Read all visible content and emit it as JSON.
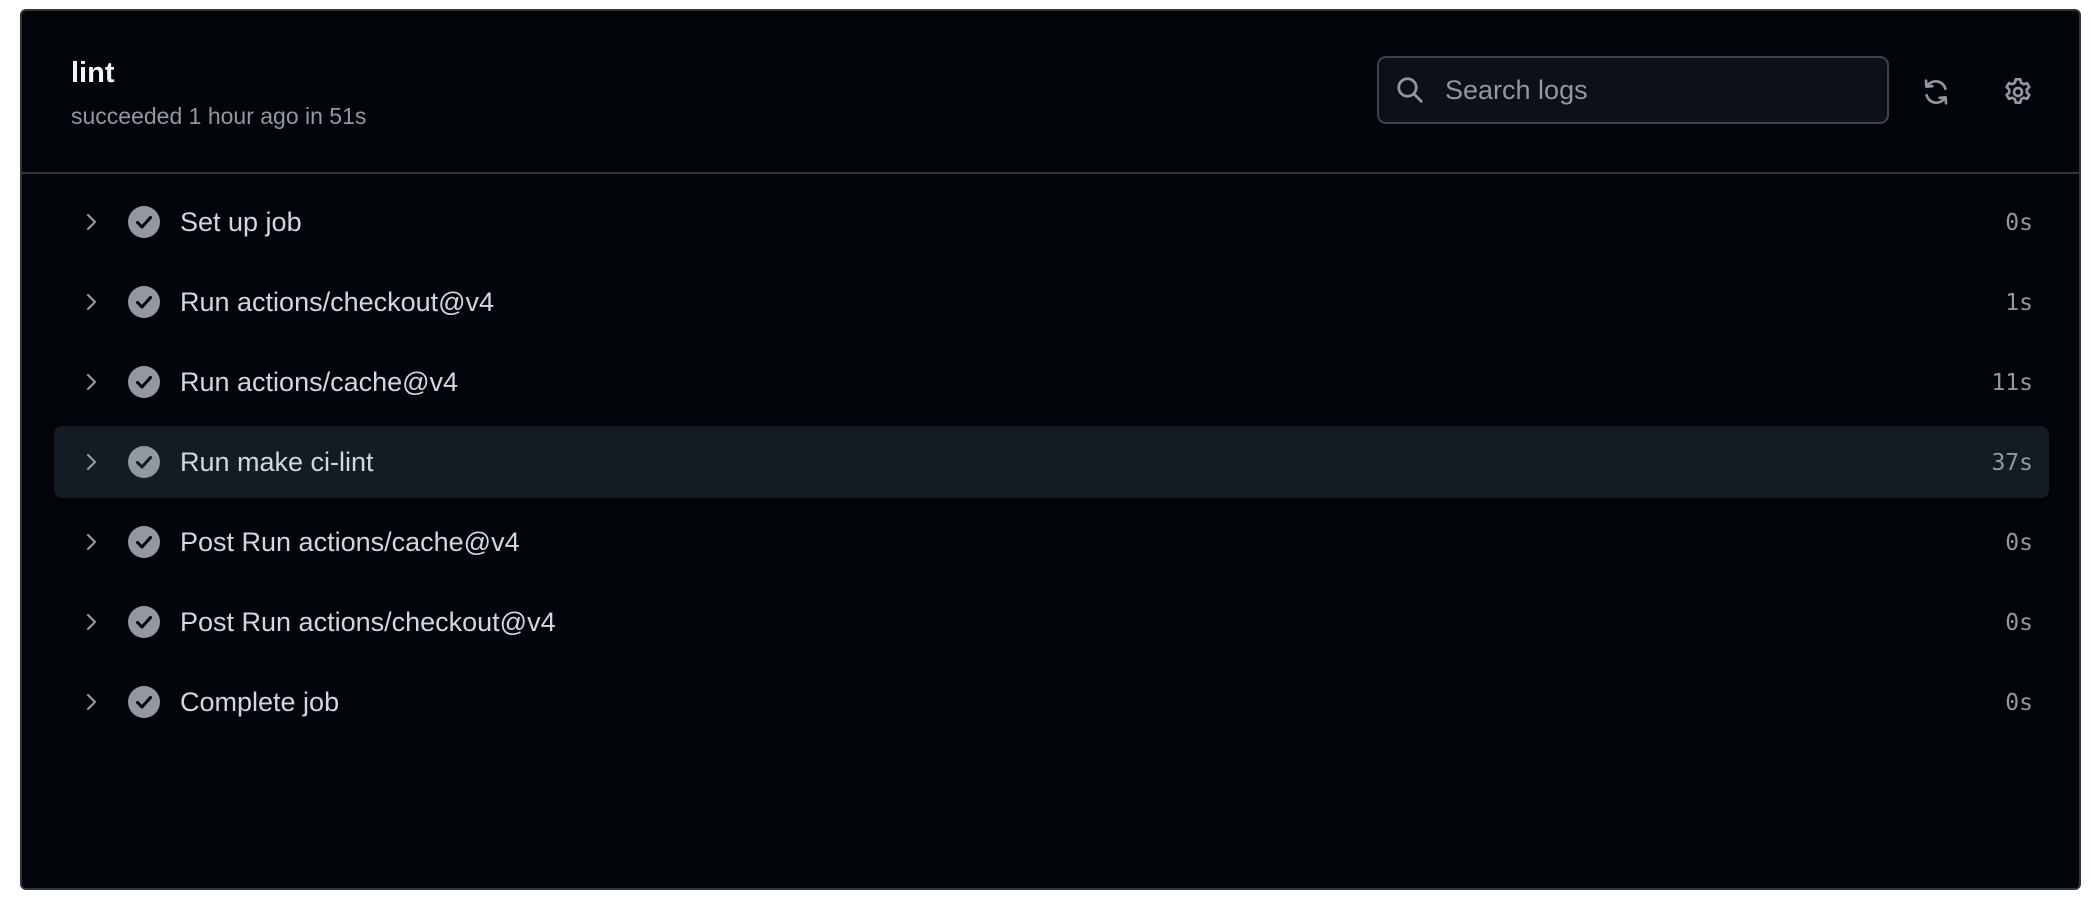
{
  "job": {
    "title": "lint",
    "status_text": "succeeded 1 hour ago in 51s"
  },
  "toolbar": {
    "search_placeholder": "Search logs",
    "search_value": "",
    "refresh_icon": "sync-icon",
    "settings_icon": "gear-icon"
  },
  "colors": {
    "background": "#010409",
    "border": "#30363d",
    "highlight_row": "#151b23",
    "text_primary": "#f0f6fc",
    "text_muted": "#9198a1",
    "success_icon": "#9198a1"
  },
  "steps": [
    {
      "name": "Set up job",
      "duration": "0s",
      "status": "success",
      "highlighted": false
    },
    {
      "name": "Run actions/checkout@v4",
      "duration": "1s",
      "status": "success",
      "highlighted": false
    },
    {
      "name": "Run actions/cache@v4",
      "duration": "11s",
      "status": "success",
      "highlighted": false
    },
    {
      "name": "Run make ci-lint",
      "duration": "37s",
      "status": "success",
      "highlighted": true
    },
    {
      "name": "Post Run actions/cache@v4",
      "duration": "0s",
      "status": "success",
      "highlighted": false
    },
    {
      "name": "Post Run actions/checkout@v4",
      "duration": "0s",
      "status": "success",
      "highlighted": false
    },
    {
      "name": "Complete job",
      "duration": "0s",
      "status": "success",
      "highlighted": false
    }
  ]
}
